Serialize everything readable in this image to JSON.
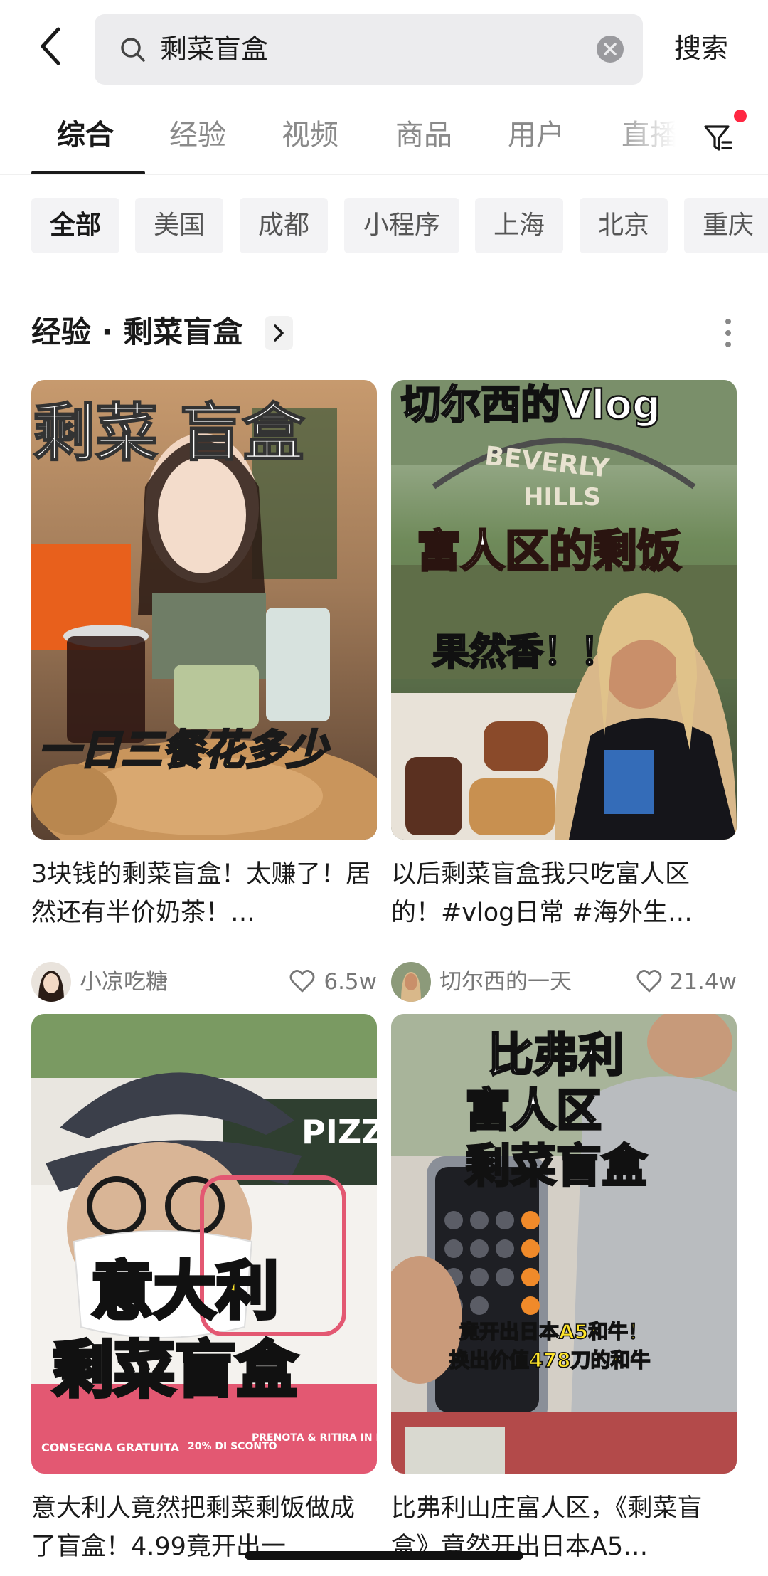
{
  "search": {
    "query": "剩菜盲盒",
    "button_label": "搜索"
  },
  "tabs": [
    {
      "label": "综合",
      "active": true
    },
    {
      "label": "经验",
      "active": false
    },
    {
      "label": "视频",
      "active": false
    },
    {
      "label": "商品",
      "active": false
    },
    {
      "label": "用户",
      "active": false
    },
    {
      "label": "直播",
      "active": false
    }
  ],
  "chips": [
    {
      "label": "全部",
      "active": true
    },
    {
      "label": "美国",
      "active": false
    },
    {
      "label": "成都",
      "active": false
    },
    {
      "label": "小程序",
      "active": false
    },
    {
      "label": "上海",
      "active": false
    },
    {
      "label": "北京",
      "active": false
    },
    {
      "label": "重庆",
      "active": false
    }
  ],
  "section": {
    "title": "经验 · 剩菜盲盒"
  },
  "cards": [
    {
      "overlay": [
        "剩菜  盲盒",
        "一日三餐花多少"
      ],
      "title": "3块钱的剩菜盲盒！太赚了！居然还有半价奶茶！…",
      "author": "小凉吃糖",
      "likes": "6.5w"
    },
    {
      "overlay": [
        "切尔西的Vlog",
        "BEVERLY",
        "HILLS",
        "富人区的剩饭",
        "果然香！！"
      ],
      "title": "以后剩菜盲盒我只吃富人区的！#vlog日常 #海外生…",
      "author": "切尔西的一天",
      "likes": "21.4w"
    },
    {
      "overlay": [
        "PIZZ",
        "意大利",
        "剩菜盲盒",
        "CONSEGNA GRATUITA",
        "20% DI SCONTO",
        "PRENOTA & RITIRA IN NEGOZIO"
      ],
      "title": "意大利人竟然把剩菜剩饭做成了盲盒！4.99竟开出一…",
      "author": "",
      "likes": ""
    },
    {
      "overlay": [
        "比弗利",
        "富人区",
        "剩菜盲盒",
        "竟开出日本A5和牛！",
        "换出价值478刀的和牛"
      ],
      "title": "比弗利山庄富人区，《剩菜盲盒》竟然开出日本A5…",
      "author": "",
      "likes": ""
    }
  ],
  "colors": {
    "accent_red": "#ff2742",
    "search_bg": "#ececee",
    "chip_bg": "#f3f3f5",
    "text_primary": "#1a1a1a",
    "text_secondary": "#777777"
  }
}
